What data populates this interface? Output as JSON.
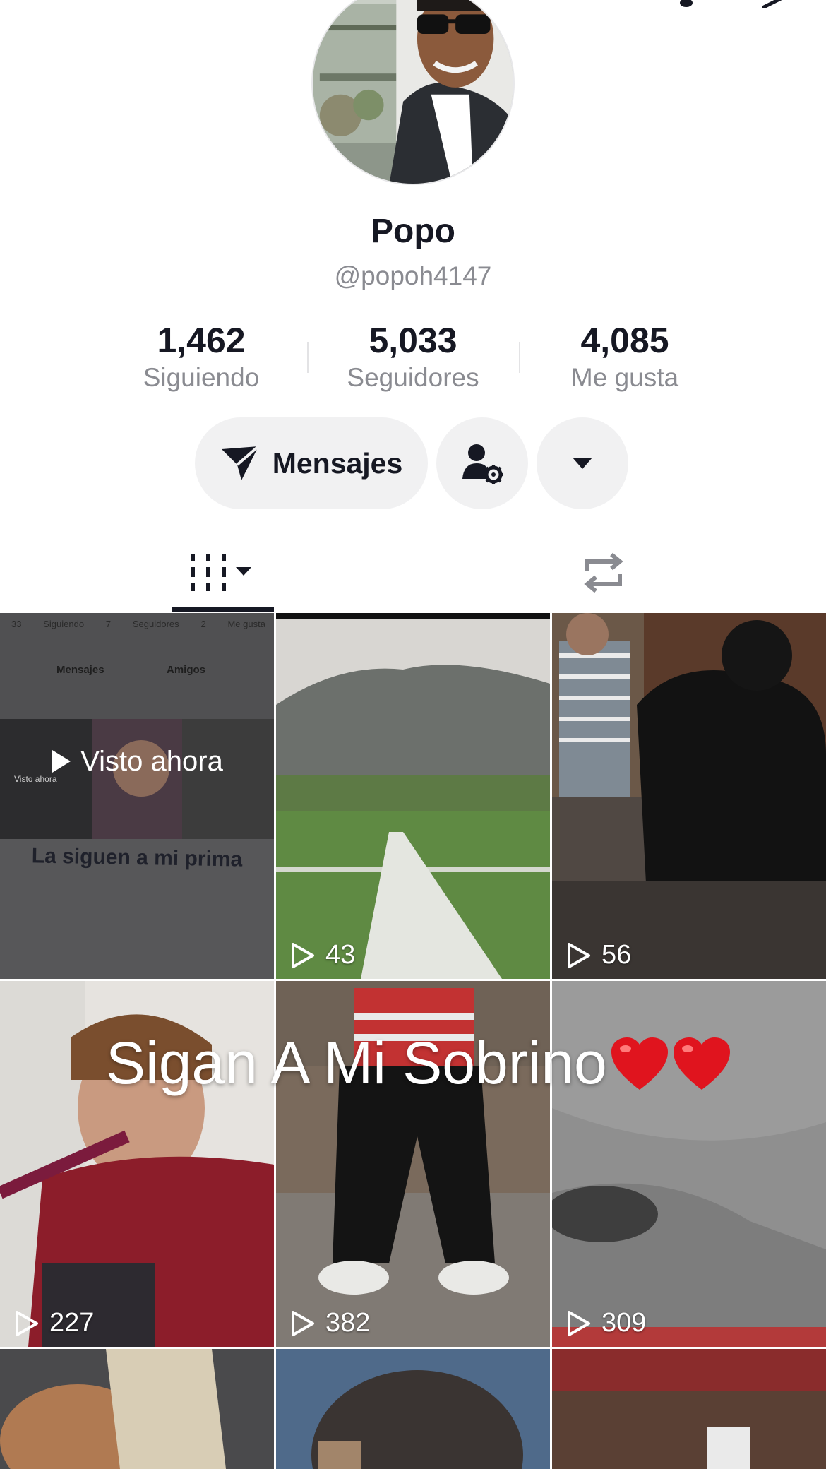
{
  "profile": {
    "display_name": "Popo",
    "username": "@popoh4147"
  },
  "stats": [
    {
      "value": "1,462",
      "label": "Siguiendo"
    },
    {
      "value": "5,033",
      "label": "Seguidores"
    },
    {
      "value": "4,085",
      "label": "Me gusta"
    }
  ],
  "actions": {
    "message_label": "Mensajes"
  },
  "grid": {
    "pinned": {
      "overlay_label": "Visto ahora",
      "caption": "La siguen a mi prima",
      "embedded_stats": [
        "33",
        "Siguiendo",
        "7",
        "Seguidores",
        "2",
        "Me gusta"
      ],
      "embedded_buttons": [
        "Mensajes",
        "Amigos",
        "Visto ahora"
      ]
    },
    "tiles": [
      {
        "views": "43"
      },
      {
        "views": "56"
      },
      {
        "views": "227"
      },
      {
        "views": "382"
      },
      {
        "views": "309"
      }
    ],
    "video_caption": "Sigan A Mi Sobrino"
  },
  "colors": {
    "text_primary": "#161823",
    "text_secondary": "#8a8b91",
    "button_bg": "#f1f1f2",
    "heart": "#e0141e"
  }
}
